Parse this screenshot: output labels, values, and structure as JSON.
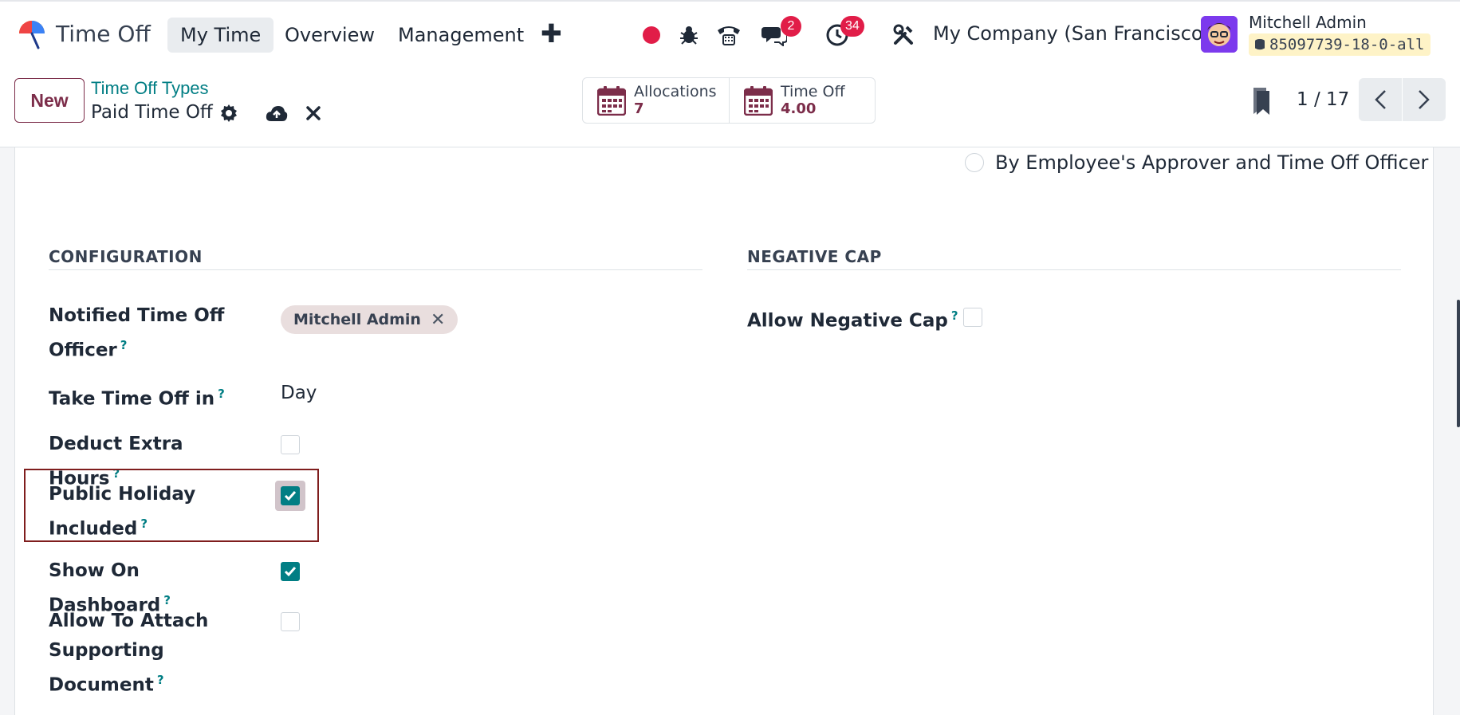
{
  "navbar": {
    "app_name": "Time Off",
    "menu": [
      "My Time",
      "Overview",
      "Management"
    ],
    "active_menu": "My Time",
    "messages_count": "2",
    "activities_count": "34",
    "company": "My Company (San Francisco)",
    "user_name": "Mitchell Admin",
    "database": "85097739-18-0-all"
  },
  "control_panel": {
    "new_label": "New",
    "breadcrumb_parent": "Time Off Types",
    "record_name": "Paid Time Off",
    "stats": [
      {
        "label": "Allocations",
        "value": "7"
      },
      {
        "label": "Time Off",
        "value": "4.00"
      }
    ],
    "pager": "1 / 17"
  },
  "form": {
    "approval_option": "By Employee's Approver and Time Off Officer",
    "configuration": {
      "title": "CONFIGURATION",
      "notified_officer_label": "Notified Time Off Officer",
      "notified_officer_tag": "Mitchell Admin",
      "take_time_off_label": "Take Time Off in",
      "take_time_off_value": "Day",
      "deduct_extra_hours_label": "Deduct Extra Hours",
      "deduct_extra_hours": false,
      "public_holiday_label": "Public Holiday Included",
      "public_holiday": true,
      "show_dashboard_label": "Show On Dashboard",
      "show_dashboard": true,
      "attach_document_label": "Allow To Attach Supporting Document",
      "attach_document": false
    },
    "negative_cap": {
      "title": "NEGATIVE CAP",
      "allow_label": "Allow Negative Cap",
      "allow": false
    },
    "help_mark": "?"
  },
  "colors": {
    "primary": "#7c2d4a",
    "accent": "#017e84",
    "badge": "#e11d48",
    "highlight": "#7f1d1d"
  }
}
